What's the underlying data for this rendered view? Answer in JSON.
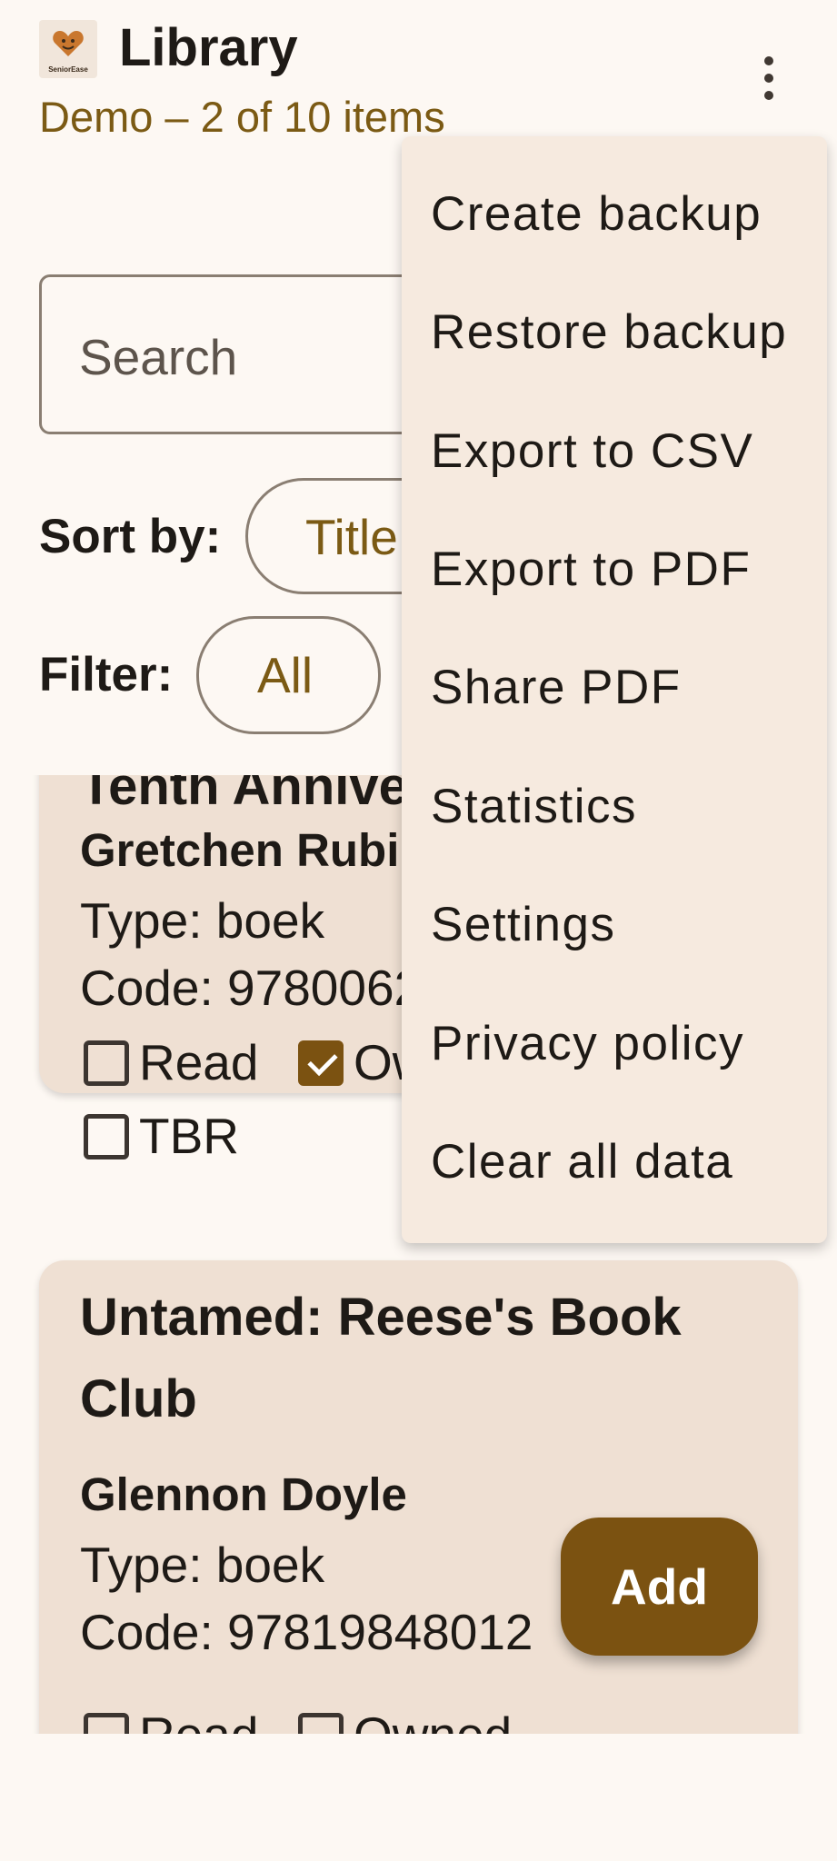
{
  "header": {
    "title": "Library",
    "subtitle": "Demo – 2 of 10 items",
    "logo_text": "SeniorEase"
  },
  "search": {
    "placeholder": "Search"
  },
  "sort": {
    "label": "Sort by:",
    "value": "Title"
  },
  "filter": {
    "label": "Filter:",
    "value": "All"
  },
  "cards": [
    {
      "title": "Tenth Anniversary",
      "author": "Gretchen Rubin",
      "type": "Type: boek",
      "code": "Code: 97800622",
      "checks": [
        {
          "label": "Read",
          "checked": false
        },
        {
          "label": "Owned",
          "checked": true
        },
        {
          "label": "TBR",
          "checked": false
        }
      ]
    },
    {
      "title_line1": "Untamed: Reese's Book",
      "title_line2": "Club",
      "author": "Glennon Doyle",
      "type": "Type: boek",
      "code": "Code: 97819848012",
      "checks": [
        {
          "label": "Read",
          "checked": false
        },
        {
          "label": "Owned",
          "checked": false
        }
      ]
    }
  ],
  "fab": {
    "label": "Add"
  },
  "menu": {
    "items": [
      "Create backup",
      "Restore backup",
      "Export to CSV",
      "Export to PDF",
      "Share PDF",
      "Statistics",
      "Settings",
      "Privacy policy",
      "Clear all data"
    ]
  },
  "colors": {
    "background": "#FDF8F3",
    "accent": "#7B5211",
    "subtitle": "#7B5A14",
    "card": "#EFE0D3",
    "menu": "#F6EADF"
  }
}
